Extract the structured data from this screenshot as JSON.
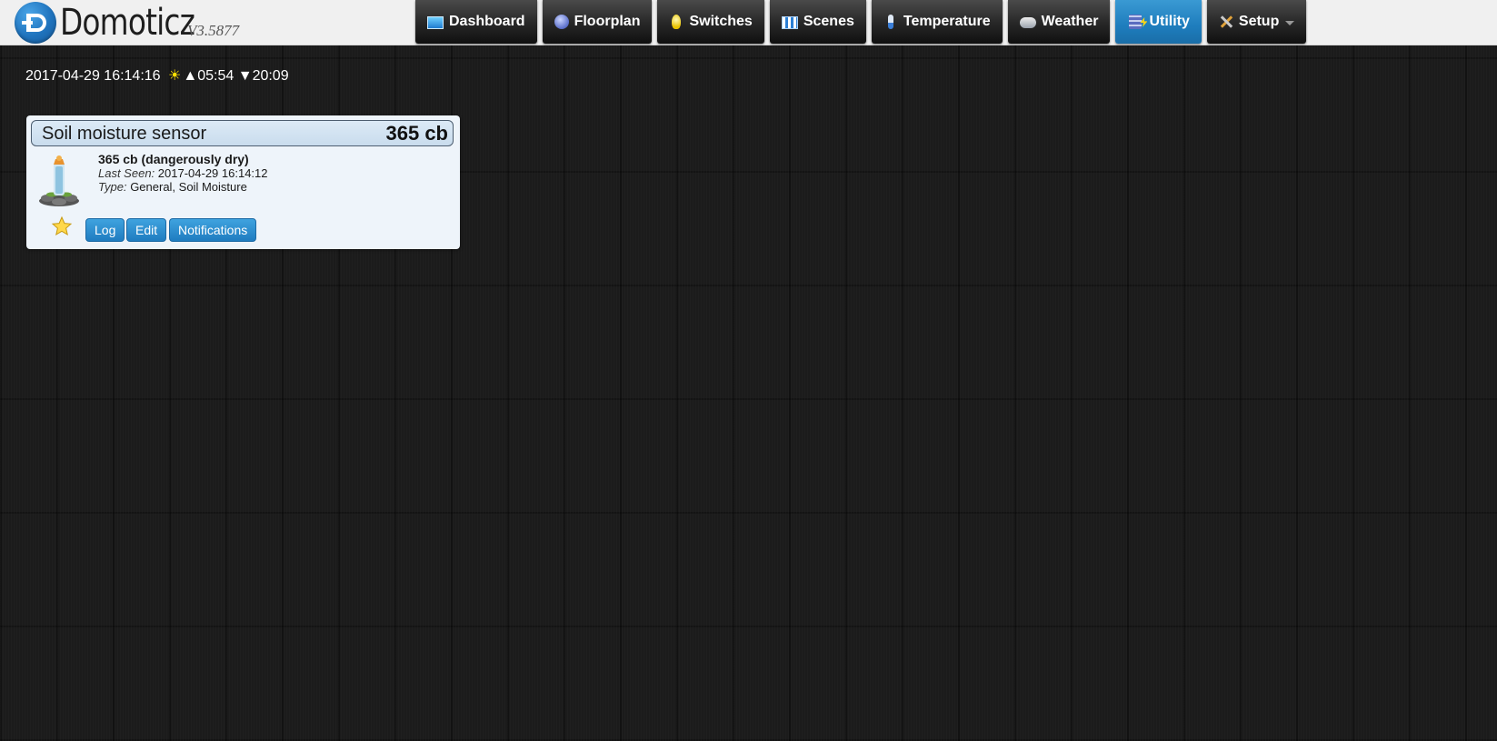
{
  "header": {
    "logo_text": "Domoticz",
    "version": "V3.5877"
  },
  "nav": {
    "items": [
      {
        "label": "Dashboard",
        "icon": "dashboard-icon"
      },
      {
        "label": "Floorplan",
        "icon": "floorplan-icon"
      },
      {
        "label": "Switches",
        "icon": "lightbulb-icon"
      },
      {
        "label": "Scenes",
        "icon": "clapperboard-icon"
      },
      {
        "label": "Temperature",
        "icon": "thermometer-icon"
      },
      {
        "label": "Weather",
        "icon": "rain-cloud-icon"
      },
      {
        "label": "Utility",
        "icon": "utility-meter-icon",
        "active": true
      },
      {
        "label": "Setup",
        "icon": "tools-icon",
        "has_dropdown": true
      }
    ],
    "active_color": "#1e7dbd"
  },
  "timebar": {
    "datetime": "2017-04-29 16:14:16",
    "sunrise_symbol": "▲",
    "sunrise": "05:54",
    "sunset_symbol": "▼",
    "sunset": "20:09"
  },
  "device": {
    "name": "Soil moisture sensor",
    "value": "365 cb",
    "status": "365 cb (dangerously dry)",
    "last_seen_label": "Last Seen:",
    "last_seen": "2017-04-29 16:14:12",
    "type_label": "Type:",
    "type": "General, Soil Moisture",
    "favorite": true,
    "buttons": {
      "log": "Log",
      "edit": "Edit",
      "notifications": "Notifications"
    }
  }
}
